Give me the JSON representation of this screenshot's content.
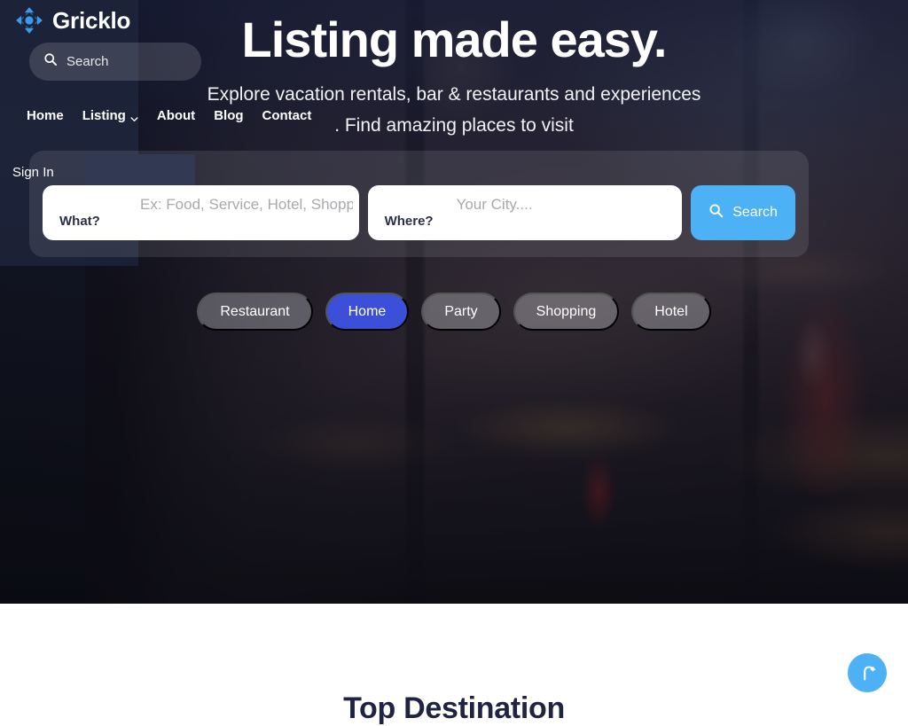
{
  "brand": {
    "name": "Gricklo",
    "logo_icon": "move-arrows-icon",
    "logo_color": "#3d9ae8"
  },
  "header": {
    "search": {
      "icon": "search-icon",
      "placeholder": "Search",
      "value": "Search"
    },
    "nav": [
      {
        "label": "Home",
        "has_dropdown": false
      },
      {
        "label": "Listing",
        "has_dropdown": true
      },
      {
        "label": "About",
        "has_dropdown": false
      },
      {
        "label": "Blog",
        "has_dropdown": false
      },
      {
        "label": "Contact",
        "has_dropdown": false
      }
    ],
    "sign_in_label": "Sign In"
  },
  "hero": {
    "title": "Listing made easy.",
    "subtitle": "Explore vacation rentals, bar & restaurants and experiences . Find amazing places to visit"
  },
  "search_form": {
    "what": {
      "label": "What?",
      "placeholder": "Ex: Food, Service, Hotel, Shopping",
      "value": ""
    },
    "where": {
      "label": "Where?",
      "placeholder": "Your City....",
      "value": ""
    },
    "submit": {
      "label": "Search",
      "icon": "search-icon",
      "color": "#4db2f5"
    }
  },
  "categories": {
    "active": "Home",
    "active_color": "#3b4fd8",
    "items": [
      {
        "label": "Restaurant",
        "active": false
      },
      {
        "label": "Home",
        "active": true
      },
      {
        "label": "Party",
        "active": false
      },
      {
        "label": "Shopping",
        "active": false
      },
      {
        "label": "Hotel",
        "active": false
      }
    ]
  },
  "below_section": {
    "title": "Top Destination"
  },
  "scroll_top": {
    "icon": "arrow-up-icon",
    "color": "#4db2f5"
  }
}
